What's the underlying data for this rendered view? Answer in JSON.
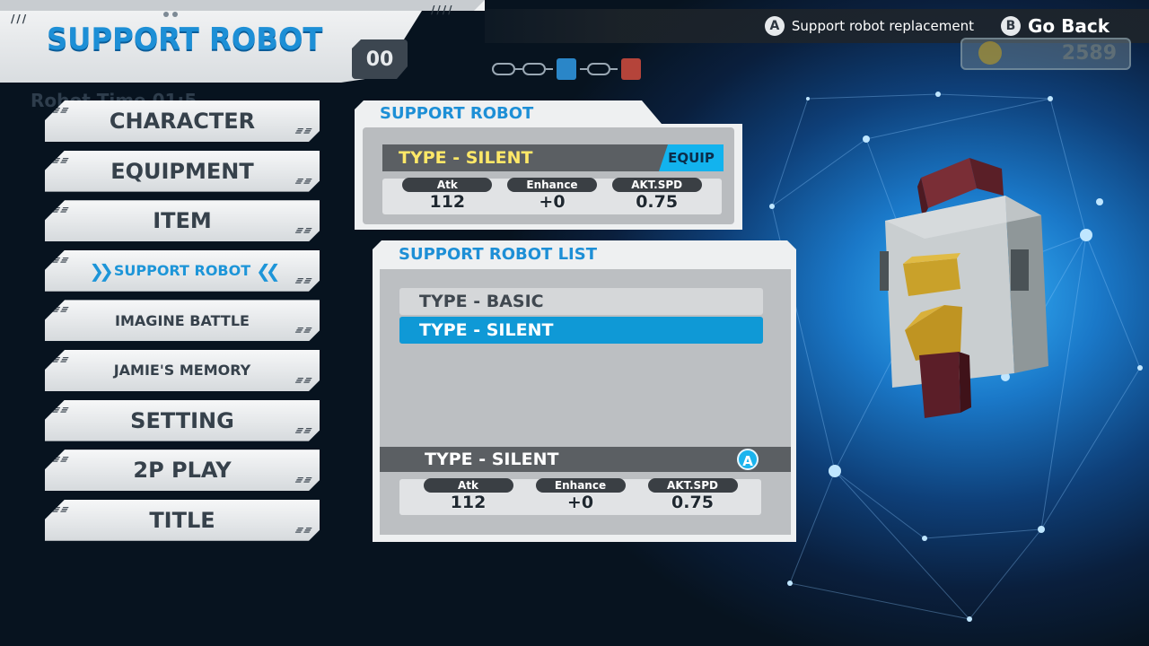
{
  "header": {
    "title": "SUPPORT ROBOT",
    "badge": "00"
  },
  "controls": [
    {
      "button": "A",
      "label": "Support robot replacement"
    },
    {
      "button": "B",
      "label": "Go Back"
    }
  ],
  "score": "2589",
  "ghost_text": "Robot Time     01:5",
  "menu": {
    "items": [
      {
        "label": "CHARACTER",
        "active": false
      },
      {
        "label": "EQUIPMENT",
        "active": false
      },
      {
        "label": "ITEM",
        "active": false
      },
      {
        "label": "SUPPORT  ROBOT",
        "active": true
      },
      {
        "label": "IMAGINE BATTLE",
        "active": false
      },
      {
        "label": "JAMIE'S MEMORY",
        "active": false
      },
      {
        "label": "SETTING",
        "active": false
      },
      {
        "label": "2P PLAY",
        "active": false
      },
      {
        "label": "TITLE",
        "active": false
      }
    ]
  },
  "support_panel": {
    "heading": "SUPPORT ROBOT",
    "equipped_type": "TYPE - SILENT",
    "equip_tag": "EQUIP",
    "stats": [
      {
        "label": "Atk",
        "value": "112"
      },
      {
        "label": "Enhance",
        "value": "+0"
      },
      {
        "label": "AKT.SPD",
        "value": "0.75"
      }
    ]
  },
  "list_panel": {
    "heading": "SUPPORT ROBOT LIST",
    "items": [
      {
        "label": "TYPE - BASIC",
        "selected": false
      },
      {
        "label": "TYPE - SILENT",
        "selected": true
      }
    ],
    "detail_type": "TYPE - SILENT",
    "detail_button": "A",
    "stats": [
      {
        "label": "Atk",
        "value": "112"
      },
      {
        "label": "Enhance",
        "value": "+0"
      },
      {
        "label": "AKT.SPD",
        "value": "0.75"
      }
    ]
  },
  "colors": {
    "accent": "#1d8fd6",
    "selected": "#0f99d6",
    "equip_tag": "#12b3ee",
    "type_text": "#ffe868"
  }
}
